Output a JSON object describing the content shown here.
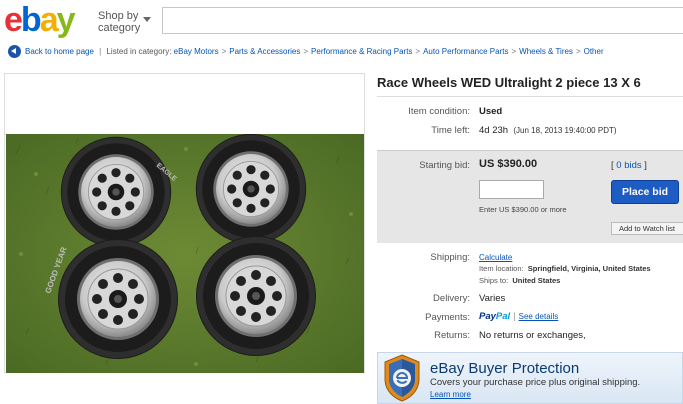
{
  "header": {
    "logo_e": "e",
    "logo_b": "b",
    "logo_a": "a",
    "logo_y": "y",
    "shop_by_line1": "Shop by",
    "shop_by_line2": "category",
    "search_placeholder": ""
  },
  "breadcrumb": {
    "back_label": "Back to home page",
    "listed_in": "Listed in category:",
    "items": [
      "eBay Motors",
      "Parts & Accessories",
      "Performance & Racing Parts",
      "Auto Performance Parts",
      "Wheels & Tires",
      "Other"
    ]
  },
  "listing": {
    "title": "Race Wheels WED Ultralight 2 piece 13 X 6",
    "condition_label": "Item condition:",
    "condition_value": "Used",
    "time_left_label": "Time left:",
    "time_left_value": "4d 23h",
    "time_left_date": "(Jun 18, 2013  19:40:00 PDT)",
    "starting_bid_label": "Starting bid:",
    "starting_bid_value": "US $390.00",
    "bids_open": "[",
    "bids_count": "0 bids",
    "bids_close": "]",
    "place_bid_label": "Place bid",
    "bid_hint": "Enter US $390.00 or more",
    "watch_label": "Add to Watch list",
    "shipping_label": "Shipping:",
    "shipping_calc": "Calculate",
    "item_location_label": "Item location:",
    "item_location_value": "Springfield, Virginia, United States",
    "ships_to_label": "Ships to:",
    "ships_to_value": "United States",
    "delivery_label": "Delivery:",
    "delivery_value": "Varies",
    "payments_label": "Payments:",
    "paypal_pay": "Pay",
    "paypal_pal": "Pal",
    "payments_sep": "|",
    "see_details": "See details",
    "returns_label": "Returns:",
    "returns_value": "No returns or exchanges,"
  },
  "protection": {
    "title": "eBay Buyer Protection",
    "subtitle": "Covers your purchase price plus original shipping.",
    "learn_more": "Learn more"
  },
  "tire_text": "GOOD YEAR",
  "tire_text_2": "EAGLE",
  "colors": {
    "link": "#0654ba",
    "place_bid": "#1d5cc2",
    "grass": "#5b7a2e"
  }
}
